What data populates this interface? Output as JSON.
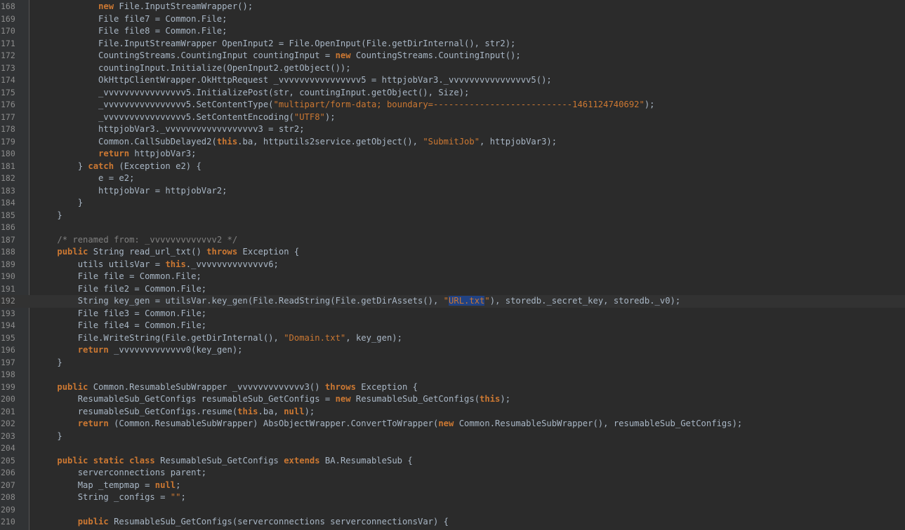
{
  "editor": {
    "theme_colors": {
      "background": "#2b2b2b",
      "keyword": "#cc7832",
      "string": "#6a8759",
      "comment": "#808080",
      "text": "#a9b7c6",
      "line_number": "#8c8c8c",
      "selection": "#214283"
    },
    "current_line": 192,
    "lines": [
      {
        "n": "168",
        "tokens": [
          [
            "t",
            "            "
          ],
          [
            "k",
            "new"
          ],
          [
            "t",
            " File.InputStreamWrapper();"
          ]
        ]
      },
      {
        "n": "169",
        "tokens": [
          [
            "t",
            "            File file7 = Common.File;"
          ]
        ]
      },
      {
        "n": "170",
        "tokens": [
          [
            "t",
            "            File file8 = Common.File;"
          ]
        ]
      },
      {
        "n": "171",
        "tokens": [
          [
            "t",
            "            File.InputStreamWrapper OpenInput2 = File.OpenInput(File.getDirInternal(), str2);"
          ]
        ]
      },
      {
        "n": "172",
        "tokens": [
          [
            "t",
            "            CountingStreams.CountingInput countingInput = "
          ],
          [
            "k",
            "new"
          ],
          [
            "t",
            " CountingStreams.CountingInput();"
          ]
        ]
      },
      {
        "n": "173",
        "tokens": [
          [
            "t",
            "            countingInput.Initialize(OpenInput2.getObject());"
          ]
        ]
      },
      {
        "n": "174",
        "tokens": [
          [
            "t",
            "            OkHttpClientWrapper.OkHttpRequest _vvvvvvvvvvvvvvvv5 = httpjobVar3._vvvvvvvvvvvvvvvv5();"
          ]
        ]
      },
      {
        "n": "175",
        "tokens": [
          [
            "t",
            "            _vvvvvvvvvvvvvvvv5.InitializePost(str, countingInput.getObject(), Size);"
          ]
        ]
      },
      {
        "n": "176",
        "tokens": [
          [
            "t",
            "            _vvvvvvvvvvvvvvvv5.SetContentType("
          ],
          [
            "s",
            "\"multipart/form-data; boundary=---------------------------1461124740692\""
          ],
          [
            "t",
            ");"
          ]
        ]
      },
      {
        "n": "177",
        "tokens": [
          [
            "t",
            "            _vvvvvvvvvvvvvvvv5.SetContentEncoding("
          ],
          [
            "s",
            "\"UTF8\""
          ],
          [
            "t",
            ");"
          ]
        ]
      },
      {
        "n": "178",
        "tokens": [
          [
            "t",
            "            httpjobVar3._vvvvvvvvvvvvvvvvvv3 = str2;"
          ]
        ]
      },
      {
        "n": "179",
        "tokens": [
          [
            "t",
            "            Common.CallSubDelayed2("
          ],
          [
            "k",
            "this"
          ],
          [
            "t",
            ".ba, httputils2service.getObject(), "
          ],
          [
            "s",
            "\"SubmitJob\""
          ],
          [
            "t",
            ", httpjobVar3);"
          ]
        ]
      },
      {
        "n": "180",
        "tokens": [
          [
            "t",
            "            "
          ],
          [
            "k",
            "return"
          ],
          [
            "t",
            " httpjobVar3;"
          ]
        ]
      },
      {
        "n": "181",
        "tokens": [
          [
            "t",
            "        } "
          ],
          [
            "k",
            "catch"
          ],
          [
            "t",
            " (Exception e2) {"
          ]
        ]
      },
      {
        "n": "182",
        "tokens": [
          [
            "t",
            "            e = e2;"
          ]
        ]
      },
      {
        "n": "183",
        "tokens": [
          [
            "t",
            "            httpjobVar = httpjobVar2;"
          ]
        ]
      },
      {
        "n": "184",
        "tokens": [
          [
            "t",
            "        }"
          ]
        ]
      },
      {
        "n": "185",
        "tokens": [
          [
            "t",
            "    }"
          ]
        ]
      },
      {
        "n": "186",
        "tokens": [
          [
            "t",
            ""
          ]
        ]
      },
      {
        "n": "187",
        "tokens": [
          [
            "t",
            "    "
          ],
          [
            "c",
            "/* renamed from: _vvvvvvvvvvvvv2 */"
          ]
        ]
      },
      {
        "n": "188",
        "tokens": [
          [
            "t",
            "    "
          ],
          [
            "k",
            "public"
          ],
          [
            "t",
            " String read_url_txt() "
          ],
          [
            "k",
            "throws"
          ],
          [
            "t",
            " Exception {"
          ]
        ]
      },
      {
        "n": "189",
        "tokens": [
          [
            "t",
            "        utils utilsVar = "
          ],
          [
            "k",
            "this"
          ],
          [
            "t",
            "._vvvvvvvvvvvvvv6;"
          ]
        ]
      },
      {
        "n": "190",
        "tokens": [
          [
            "t",
            "        File file = Common.File;"
          ]
        ]
      },
      {
        "n": "191",
        "tokens": [
          [
            "t",
            "        File file2 = Common.File;"
          ]
        ]
      },
      {
        "n": "192",
        "tokens": [
          [
            "t",
            "        String key_gen = utilsVar.key_gen(File.ReadString(File.getDirAssets(), "
          ],
          [
            "s",
            "\""
          ],
          [
            "x",
            "URL.txt"
          ],
          [
            "s",
            "\""
          ],
          [
            "t",
            "), storedb._secret_key, storedb._v0);"
          ]
        ]
      },
      {
        "n": "193",
        "tokens": [
          [
            "t",
            "        File file3 = Common.File;"
          ]
        ]
      },
      {
        "n": "194",
        "tokens": [
          [
            "t",
            "        File file4 = Common.File;"
          ]
        ]
      },
      {
        "n": "195",
        "tokens": [
          [
            "t",
            "        File.WriteString(File.getDirInternal(), "
          ],
          [
            "s",
            "\"Domain.txt\""
          ],
          [
            "t",
            ", key_gen);"
          ]
        ]
      },
      {
        "n": "196",
        "tokens": [
          [
            "t",
            "        "
          ],
          [
            "k",
            "return"
          ],
          [
            "t",
            " _vvvvvvvvvvvvv0(key_gen);"
          ]
        ]
      },
      {
        "n": "197",
        "tokens": [
          [
            "t",
            "    }"
          ]
        ]
      },
      {
        "n": "198",
        "tokens": [
          [
            "t",
            ""
          ]
        ]
      },
      {
        "n": "199",
        "tokens": [
          [
            "t",
            "    "
          ],
          [
            "k",
            "public"
          ],
          [
            "t",
            " Common.ResumableSubWrapper _vvvvvvvvvvvvv3() "
          ],
          [
            "k",
            "throws"
          ],
          [
            "t",
            " Exception {"
          ]
        ]
      },
      {
        "n": "200",
        "tokens": [
          [
            "t",
            "        ResumableSub_GetConfigs resumableSub_GetConfigs = "
          ],
          [
            "k",
            "new"
          ],
          [
            "t",
            " ResumableSub_GetConfigs("
          ],
          [
            "k",
            "this"
          ],
          [
            "t",
            ");"
          ]
        ]
      },
      {
        "n": "201",
        "tokens": [
          [
            "t",
            "        resumableSub_GetConfigs.resume("
          ],
          [
            "k",
            "this"
          ],
          [
            "t",
            ".ba, "
          ],
          [
            "k",
            "null"
          ],
          [
            "t",
            ");"
          ]
        ]
      },
      {
        "n": "202",
        "tokens": [
          [
            "t",
            "        "
          ],
          [
            "k",
            "return"
          ],
          [
            "t",
            " (Common.ResumableSubWrapper) AbsObjectWrapper.ConvertToWrapper("
          ],
          [
            "k",
            "new"
          ],
          [
            "t",
            " Common.ResumableSubWrapper(), resumableSub_GetConfigs);"
          ]
        ]
      },
      {
        "n": "203",
        "tokens": [
          [
            "t",
            "    }"
          ]
        ]
      },
      {
        "n": "204",
        "tokens": [
          [
            "t",
            ""
          ]
        ]
      },
      {
        "n": "205",
        "tokens": [
          [
            "t",
            "    "
          ],
          [
            "k",
            "public static class"
          ],
          [
            "t",
            " ResumableSub_GetConfigs "
          ],
          [
            "k",
            "extends"
          ],
          [
            "t",
            " BA.ResumableSub {"
          ]
        ]
      },
      {
        "n": "206",
        "tokens": [
          [
            "t",
            "        serverconnections parent;"
          ]
        ]
      },
      {
        "n": "207",
        "tokens": [
          [
            "t",
            "        Map _tempmap = "
          ],
          [
            "k",
            "null"
          ],
          [
            "t",
            ";"
          ]
        ]
      },
      {
        "n": "208",
        "tokens": [
          [
            "t",
            "        String _configs = "
          ],
          [
            "s",
            "\"\""
          ],
          [
            "t",
            ";"
          ]
        ]
      },
      {
        "n": "209",
        "tokens": [
          [
            "t",
            ""
          ]
        ]
      },
      {
        "n": "210",
        "tokens": [
          [
            "t",
            "        "
          ],
          [
            "k",
            "public"
          ],
          [
            "t",
            " ResumableSub_GetConfigs(serverconnections serverconnectionsVar) {"
          ]
        ]
      }
    ]
  }
}
